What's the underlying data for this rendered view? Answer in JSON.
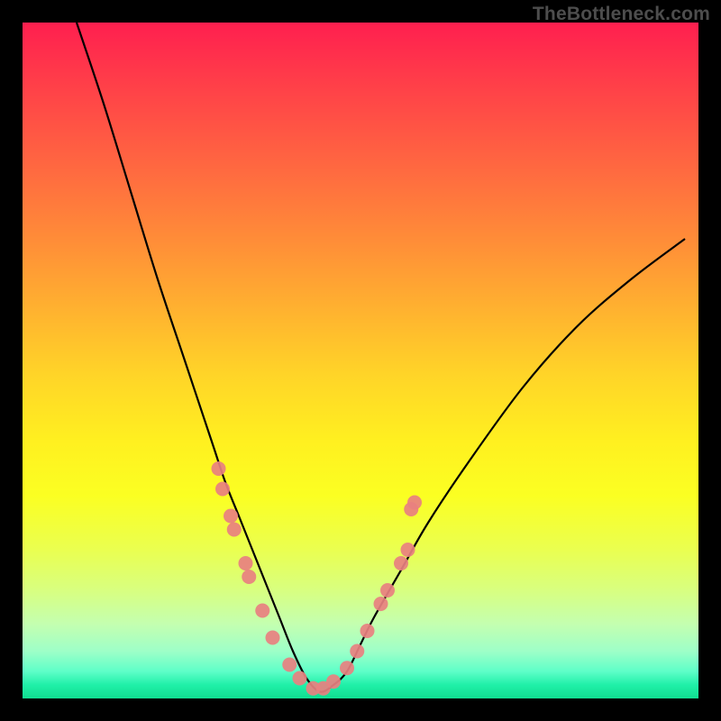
{
  "watermark": "TheBottleneck.com",
  "colors": {
    "frame": "#000000",
    "curve": "#000000",
    "dot": "#e88080",
    "gradient_top": "#ff1f4f",
    "gradient_bottom": "#10dd90"
  },
  "chart_data": {
    "type": "line",
    "title": "",
    "xlabel": "",
    "ylabel": "",
    "x_range": [
      0,
      100
    ],
    "y_range": [
      0,
      100
    ],
    "comment": "Axes are unlabeled; x and y are normalized 0–100. y=0 is bottom (green), y=100 is top (red). Curve is a smooth V/valley shape — high bottleneck at extremes, near-zero around x≈43.",
    "series": [
      {
        "name": "bottleneck-curve",
        "x": [
          8,
          12,
          16,
          20,
          24,
          28,
          30,
          32,
          34,
          36,
          38,
          40,
          42,
          44,
          46,
          48,
          50,
          52,
          56,
          60,
          66,
          74,
          82,
          90,
          98
        ],
        "y": [
          100,
          88,
          75,
          62,
          50,
          38,
          32,
          27,
          22,
          17,
          12,
          7,
          3,
          1,
          2,
          4,
          8,
          12,
          19,
          26,
          35,
          46,
          55,
          62,
          68
        ]
      }
    ],
    "scatter": {
      "name": "highlighted-points",
      "comment": "Pink dots clustered on both walls of the valley near the bottom.",
      "points": [
        {
          "x": 29.0,
          "y": 34
        },
        {
          "x": 29.6,
          "y": 31
        },
        {
          "x": 30.8,
          "y": 27
        },
        {
          "x": 31.3,
          "y": 25
        },
        {
          "x": 33.0,
          "y": 20
        },
        {
          "x": 33.5,
          "y": 18
        },
        {
          "x": 35.5,
          "y": 13
        },
        {
          "x": 37.0,
          "y": 9
        },
        {
          "x": 39.5,
          "y": 5
        },
        {
          "x": 41.0,
          "y": 3
        },
        {
          "x": 43.0,
          "y": 1.5
        },
        {
          "x": 44.5,
          "y": 1.5
        },
        {
          "x": 46.0,
          "y": 2.5
        },
        {
          "x": 48.0,
          "y": 4.5
        },
        {
          "x": 49.5,
          "y": 7
        },
        {
          "x": 51.0,
          "y": 10
        },
        {
          "x": 53.0,
          "y": 14
        },
        {
          "x": 54.0,
          "y": 16
        },
        {
          "x": 56.0,
          "y": 20
        },
        {
          "x": 57.0,
          "y": 22
        },
        {
          "x": 57.5,
          "y": 28
        },
        {
          "x": 58.0,
          "y": 29
        }
      ]
    }
  }
}
